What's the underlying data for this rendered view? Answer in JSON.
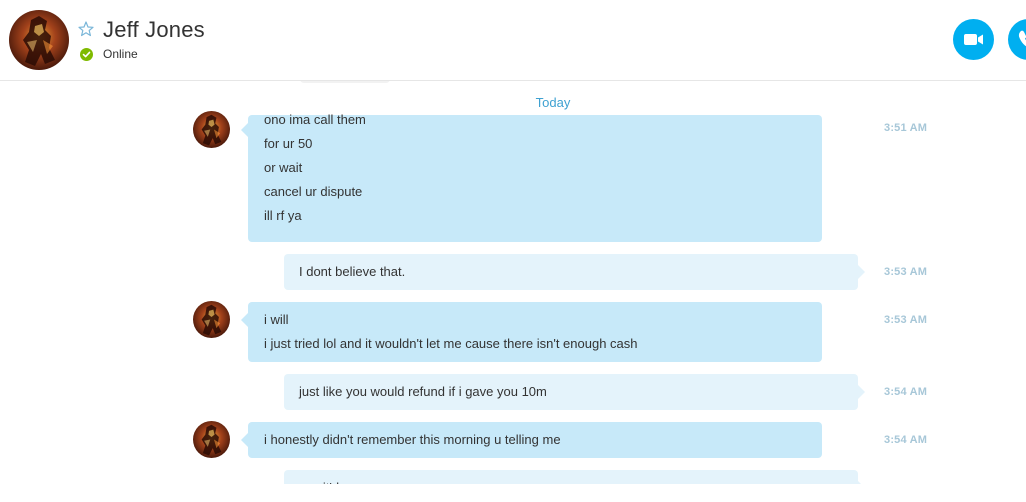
{
  "contact": {
    "name": "Jeff Jones",
    "status": "Online",
    "avatar_icon": "avatar-image",
    "favorite_icon": "star-outline-icon"
  },
  "header_actions": {
    "video_icon": "video-camera-icon",
    "call_icon": "phone-icon"
  },
  "chat": {
    "date_divider": "Today",
    "messages": [
      {
        "direction": "incoming",
        "lines": [
          "ono ima call them",
          "for ur 50",
          "or wait",
          "cancel ur dispute",
          "ill rf ya"
        ],
        "time": "3:51 AM"
      },
      {
        "direction": "outgoing",
        "lines": [
          "I dont believe that."
        ],
        "time": "3:53 AM"
      },
      {
        "direction": "incoming",
        "lines": [
          "i will",
          "i just tried lol and it wouldn't let me cause there isn't enough cash"
        ],
        "time": "3:53 AM"
      },
      {
        "direction": "outgoing",
        "lines": [
          "just like you would refund if i gave you 10m"
        ],
        "time": "3:54 AM"
      },
      {
        "direction": "incoming",
        "lines": [
          "i honestly didn't remember this morning u telling me"
        ],
        "time": "3:54 AM"
      },
      {
        "direction": "outgoing",
        "lines": [
          "yes it'd ..."
        ],
        "time": ""
      }
    ]
  },
  "colors": {
    "accent": "#00aff0",
    "online": "#7fba00",
    "incoming_bubble": "#c7e9f9",
    "outgoing_bubble": "#e4f3fb",
    "timestamp": "#a7c7d8",
    "date_divider": "#3ea1d1"
  }
}
